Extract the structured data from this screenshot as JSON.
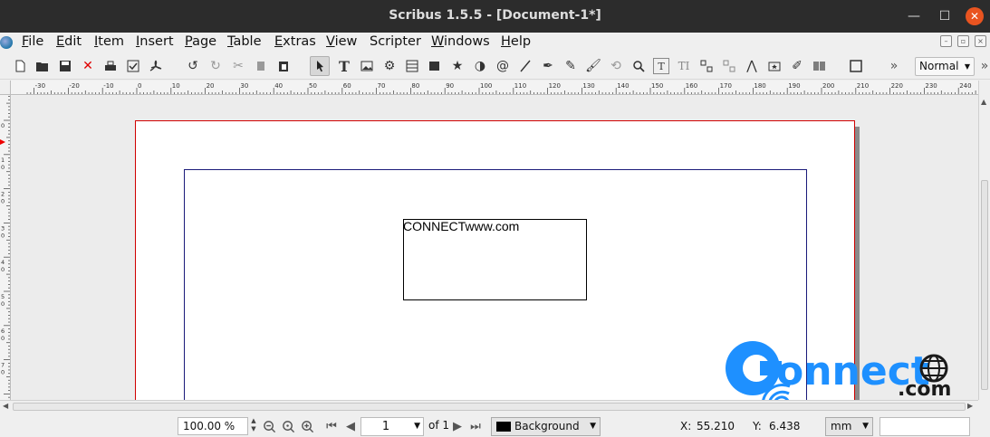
{
  "window": {
    "title": "Scribus 1.5.5 - [Document-1*]"
  },
  "menubar": {
    "items": [
      {
        "accel": "F",
        "rest": "ile"
      },
      {
        "accel": "E",
        "rest": "dit"
      },
      {
        "accel": "I",
        "rest": "tem"
      },
      {
        "accel": "I",
        "rest": "nsert"
      },
      {
        "accel": "P",
        "rest": "age"
      },
      {
        "accel": "T",
        "rest": "able"
      },
      {
        "accel": "E",
        "rest": "xtras"
      },
      {
        "accel": "V",
        "rest": "iew"
      },
      {
        "accel": "",
        "rest": "Scripter"
      },
      {
        "accel": "W",
        "rest": "indows"
      },
      {
        "accel": "H",
        "rest": "elp"
      }
    ]
  },
  "toolbar": {
    "style_value": "Normal",
    "overflow": "»"
  },
  "ruler": {
    "h_labels": [
      "-30",
      "-20",
      "-10",
      "0",
      "10",
      "20",
      "30",
      "40",
      "50",
      "60",
      "70",
      "80",
      "90",
      "100",
      "110",
      "120",
      "130",
      "140",
      "150",
      "160",
      "170",
      "180",
      "190",
      "200",
      "210",
      "220",
      "230",
      "240"
    ],
    "v_labels": [
      "0",
      "1\n0",
      "2\n0",
      "3\n0",
      "4\n0",
      "5\n0",
      "6\n0",
      "7\n0"
    ]
  },
  "document": {
    "text_frame_content": "CONNECTwww.com"
  },
  "watermark": {
    "word": "onnect",
    "domain": ".com"
  },
  "statusbar": {
    "zoom": "100.00 %",
    "page_number": "1",
    "page_of": "of 1",
    "layer": "Background",
    "x_label": "X:",
    "x_value": "55.210",
    "y_label": "Y:",
    "y_value": "6.438",
    "unit": "mm"
  },
  "colors": {
    "titlebar": "#2c2c2c",
    "close_button": "#e95420",
    "page_border": "#d00000",
    "margin_guide": "#1a1a7a",
    "watermark_blue": "#1e90ff"
  }
}
